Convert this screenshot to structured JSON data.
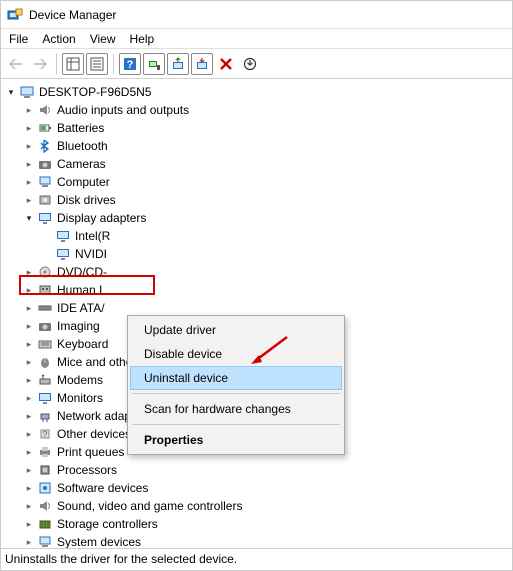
{
  "window": {
    "title": "Device Manager"
  },
  "menu": {
    "file": "File",
    "action": "Action",
    "view": "View",
    "help": "Help"
  },
  "tree": {
    "root": "DESKTOP-F96D5N5",
    "items": [
      {
        "label": "Audio inputs and outputs"
      },
      {
        "label": "Batteries"
      },
      {
        "label": "Bluetooth"
      },
      {
        "label": "Cameras"
      },
      {
        "label": "Computer"
      },
      {
        "label": "Disk drives"
      },
      {
        "label": "Display adapters"
      },
      {
        "label": "DVD/CD-"
      },
      {
        "label": "Human I"
      },
      {
        "label": "IDE ATA/"
      },
      {
        "label": "Imaging"
      },
      {
        "label": "Keyboard"
      },
      {
        "label": "Mice and other pointing devices"
      },
      {
        "label": "Modems"
      },
      {
        "label": "Monitors"
      },
      {
        "label": "Network adapters"
      },
      {
        "label": "Other devices"
      },
      {
        "label": "Print queues"
      },
      {
        "label": "Processors"
      },
      {
        "label": "Software devices"
      },
      {
        "label": "Sound, video and game controllers"
      },
      {
        "label": "Storage controllers"
      },
      {
        "label": "System devices"
      }
    ],
    "display_children": [
      {
        "label": "Intel(R"
      },
      {
        "label": "NVIDI"
      }
    ]
  },
  "context_menu": {
    "update": "Update driver",
    "disable": "Disable device",
    "uninstall": "Uninstall device",
    "scan": "Scan for hardware changes",
    "properties": "Properties"
  },
  "status": "Uninstalls the driver for the selected device."
}
